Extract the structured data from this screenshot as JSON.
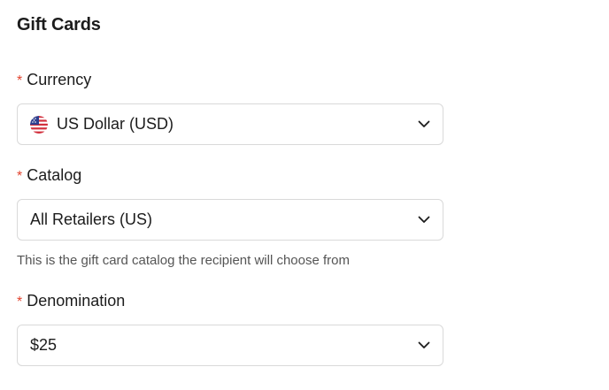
{
  "section": {
    "title": "Gift Cards"
  },
  "currency": {
    "required_mark": "*",
    "label": "Currency",
    "value": "US Dollar (USD)",
    "flag_icon": "us-flag-icon"
  },
  "catalog": {
    "required_mark": "*",
    "label": "Catalog",
    "value": "All Retailers (US)",
    "help": "This is the gift card catalog the recipient will choose from"
  },
  "denomination": {
    "required_mark": "*",
    "label": "Denomination",
    "value": "$25"
  },
  "colors": {
    "required": "#e2442f",
    "border": "#d9d9d9",
    "help_text": "#555555"
  }
}
